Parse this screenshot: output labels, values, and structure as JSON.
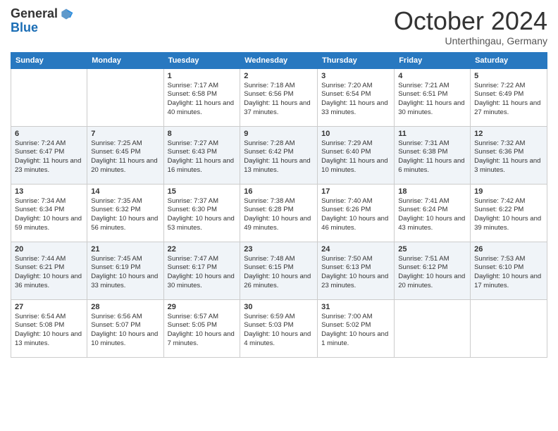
{
  "header": {
    "logo_line1": "General",
    "logo_line2": "Blue",
    "month_title": "October 2024",
    "location": "Unterthingau, Germany"
  },
  "weekdays": [
    "Sunday",
    "Monday",
    "Tuesday",
    "Wednesday",
    "Thursday",
    "Friday",
    "Saturday"
  ],
  "weeks": [
    [
      {
        "day": "",
        "info": ""
      },
      {
        "day": "",
        "info": ""
      },
      {
        "day": "1",
        "info": "Sunrise: 7:17 AM\nSunset: 6:58 PM\nDaylight: 11 hours and 40 minutes."
      },
      {
        "day": "2",
        "info": "Sunrise: 7:18 AM\nSunset: 6:56 PM\nDaylight: 11 hours and 37 minutes."
      },
      {
        "day": "3",
        "info": "Sunrise: 7:20 AM\nSunset: 6:54 PM\nDaylight: 11 hours and 33 minutes."
      },
      {
        "day": "4",
        "info": "Sunrise: 7:21 AM\nSunset: 6:51 PM\nDaylight: 11 hours and 30 minutes."
      },
      {
        "day": "5",
        "info": "Sunrise: 7:22 AM\nSunset: 6:49 PM\nDaylight: 11 hours and 27 minutes."
      }
    ],
    [
      {
        "day": "6",
        "info": "Sunrise: 7:24 AM\nSunset: 6:47 PM\nDaylight: 11 hours and 23 minutes."
      },
      {
        "day": "7",
        "info": "Sunrise: 7:25 AM\nSunset: 6:45 PM\nDaylight: 11 hours and 20 minutes."
      },
      {
        "day": "8",
        "info": "Sunrise: 7:27 AM\nSunset: 6:43 PM\nDaylight: 11 hours and 16 minutes."
      },
      {
        "day": "9",
        "info": "Sunrise: 7:28 AM\nSunset: 6:42 PM\nDaylight: 11 hours and 13 minutes."
      },
      {
        "day": "10",
        "info": "Sunrise: 7:29 AM\nSunset: 6:40 PM\nDaylight: 11 hours and 10 minutes."
      },
      {
        "day": "11",
        "info": "Sunrise: 7:31 AM\nSunset: 6:38 PM\nDaylight: 11 hours and 6 minutes."
      },
      {
        "day": "12",
        "info": "Sunrise: 7:32 AM\nSunset: 6:36 PM\nDaylight: 11 hours and 3 minutes."
      }
    ],
    [
      {
        "day": "13",
        "info": "Sunrise: 7:34 AM\nSunset: 6:34 PM\nDaylight: 10 hours and 59 minutes."
      },
      {
        "day": "14",
        "info": "Sunrise: 7:35 AM\nSunset: 6:32 PM\nDaylight: 10 hours and 56 minutes."
      },
      {
        "day": "15",
        "info": "Sunrise: 7:37 AM\nSunset: 6:30 PM\nDaylight: 10 hours and 53 minutes."
      },
      {
        "day": "16",
        "info": "Sunrise: 7:38 AM\nSunset: 6:28 PM\nDaylight: 10 hours and 49 minutes."
      },
      {
        "day": "17",
        "info": "Sunrise: 7:40 AM\nSunset: 6:26 PM\nDaylight: 10 hours and 46 minutes."
      },
      {
        "day": "18",
        "info": "Sunrise: 7:41 AM\nSunset: 6:24 PM\nDaylight: 10 hours and 43 minutes."
      },
      {
        "day": "19",
        "info": "Sunrise: 7:42 AM\nSunset: 6:22 PM\nDaylight: 10 hours and 39 minutes."
      }
    ],
    [
      {
        "day": "20",
        "info": "Sunrise: 7:44 AM\nSunset: 6:21 PM\nDaylight: 10 hours and 36 minutes."
      },
      {
        "day": "21",
        "info": "Sunrise: 7:45 AM\nSunset: 6:19 PM\nDaylight: 10 hours and 33 minutes."
      },
      {
        "day": "22",
        "info": "Sunrise: 7:47 AM\nSunset: 6:17 PM\nDaylight: 10 hours and 30 minutes."
      },
      {
        "day": "23",
        "info": "Sunrise: 7:48 AM\nSunset: 6:15 PM\nDaylight: 10 hours and 26 minutes."
      },
      {
        "day": "24",
        "info": "Sunrise: 7:50 AM\nSunset: 6:13 PM\nDaylight: 10 hours and 23 minutes."
      },
      {
        "day": "25",
        "info": "Sunrise: 7:51 AM\nSunset: 6:12 PM\nDaylight: 10 hours and 20 minutes."
      },
      {
        "day": "26",
        "info": "Sunrise: 7:53 AM\nSunset: 6:10 PM\nDaylight: 10 hours and 17 minutes."
      }
    ],
    [
      {
        "day": "27",
        "info": "Sunrise: 6:54 AM\nSunset: 5:08 PM\nDaylight: 10 hours and 13 minutes."
      },
      {
        "day": "28",
        "info": "Sunrise: 6:56 AM\nSunset: 5:07 PM\nDaylight: 10 hours and 10 minutes."
      },
      {
        "day": "29",
        "info": "Sunrise: 6:57 AM\nSunset: 5:05 PM\nDaylight: 10 hours and 7 minutes."
      },
      {
        "day": "30",
        "info": "Sunrise: 6:59 AM\nSunset: 5:03 PM\nDaylight: 10 hours and 4 minutes."
      },
      {
        "day": "31",
        "info": "Sunrise: 7:00 AM\nSunset: 5:02 PM\nDaylight: 10 hours and 1 minute."
      },
      {
        "day": "",
        "info": ""
      },
      {
        "day": "",
        "info": ""
      }
    ]
  ]
}
